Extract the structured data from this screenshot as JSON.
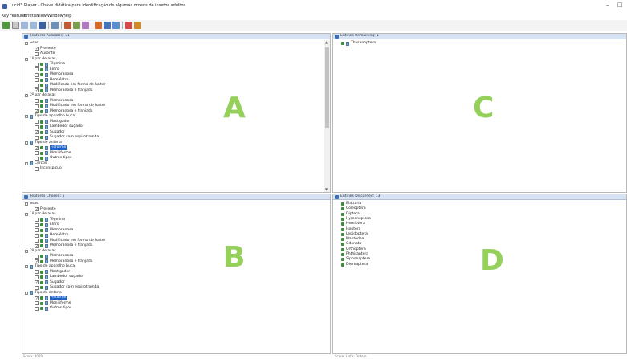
{
  "window": {
    "title": "Lucid3 Player - Chave didática para identificação de algumas ordens de insetos adultos",
    "minimize": "–",
    "maximize": "□"
  },
  "menu": [
    "Key",
    "Features",
    "Entities",
    "View",
    "Window",
    "Help"
  ],
  "toolbar_icons": [
    "restart-icon",
    "open-icon",
    "copy-icon",
    "paste-icon",
    "binoculars-icon",
    "filter-icon",
    "tools-icon",
    "prune-icon",
    "wand-icon",
    "differences-icon",
    "best-icon",
    "next-icon",
    "check-icon",
    "book-icon"
  ],
  "panes": {
    "features_available": {
      "header": "Features Available: 31",
      "letter": "A",
      "rows": [
        {
          "t": "Asas",
          "lvl": 0,
          "kind": "group"
        },
        {
          "t": "Presente",
          "lvl": 1,
          "kind": "state",
          "checked": true
        },
        {
          "t": "Ausente",
          "lvl": 1,
          "kind": "state",
          "checked": false
        },
        {
          "t": "1º par de asas",
          "lvl": 0,
          "kind": "group"
        },
        {
          "t": "Tégmina",
          "lvl": 1,
          "kind": "state2",
          "checked": false
        },
        {
          "t": "Élitro",
          "lvl": 1,
          "kind": "state2",
          "checked": false
        },
        {
          "t": "Membranosa",
          "lvl": 1,
          "kind": "state2",
          "checked": false
        },
        {
          "t": "Hemiélitro",
          "lvl": 1,
          "kind": "state2",
          "checked": false
        },
        {
          "t": "Modificado em forma de halter",
          "lvl": 1,
          "kind": "state2",
          "checked": false
        },
        {
          "t": "Membranosa e franjada",
          "lvl": 1,
          "kind": "state2",
          "checked": true
        },
        {
          "t": "2º par de asas",
          "lvl": 0,
          "kind": "group"
        },
        {
          "t": "Membranosa",
          "lvl": 1,
          "kind": "state2",
          "checked": false
        },
        {
          "t": "Modificado em forma de halter",
          "lvl": 1,
          "kind": "state2",
          "checked": false
        },
        {
          "t": "Membranosa e franjada",
          "lvl": 1,
          "kind": "state2",
          "checked": true
        },
        {
          "t": "Tipo de aparelho bucal",
          "lvl": 0,
          "kind": "group2"
        },
        {
          "t": "Mastigador",
          "lvl": 1,
          "kind": "state2",
          "checked": false
        },
        {
          "t": "Lambedor sugador",
          "lvl": 1,
          "kind": "state2",
          "checked": false
        },
        {
          "t": "Sugador",
          "lvl": 1,
          "kind": "state2",
          "checked": true
        },
        {
          "t": "Sugador com espirotromba",
          "lvl": 1,
          "kind": "state2",
          "checked": false
        },
        {
          "t": "Tipo de antena",
          "lvl": 0,
          "kind": "group2"
        },
        {
          "t": "Filiforme",
          "lvl": 1,
          "kind": "state2",
          "checked": true,
          "selected": true
        },
        {
          "t": "Moniliforme",
          "lvl": 1,
          "kind": "state2",
          "checked": false
        },
        {
          "t": "Outros tipos",
          "lvl": 1,
          "kind": "state2",
          "checked": false
        },
        {
          "t": "Cercos",
          "lvl": 0,
          "kind": "group2"
        },
        {
          "t": "Inconspícuo",
          "lvl": 1,
          "kind": "state",
          "checked": false
        }
      ]
    },
    "features_chosen": {
      "header": "Features Chosen: 5",
      "letter": "B",
      "rows": [
        {
          "t": "Asas",
          "lvl": 0,
          "kind": "group"
        },
        {
          "t": "Presente",
          "lvl": 1,
          "kind": "state",
          "checked": true
        },
        {
          "t": "1º par de asas",
          "lvl": 0,
          "kind": "group"
        },
        {
          "t": "Tégmina",
          "lvl": 1,
          "kind": "state2",
          "checked": false
        },
        {
          "t": "Élitro",
          "lvl": 1,
          "kind": "state2",
          "checked": false
        },
        {
          "t": "Membranosa",
          "lvl": 1,
          "kind": "state2",
          "checked": false
        },
        {
          "t": "Hemiélitro",
          "lvl": 1,
          "kind": "state2",
          "checked": false
        },
        {
          "t": "Modificado em forma de halter",
          "lvl": 1,
          "kind": "state2",
          "checked": false
        },
        {
          "t": "Membranosa e franjada",
          "lvl": 1,
          "kind": "state2",
          "checked": true
        },
        {
          "t": "2º par de asas",
          "lvl": 0,
          "kind": "group"
        },
        {
          "t": "Membranosa",
          "lvl": 1,
          "kind": "state2",
          "checked": false
        },
        {
          "t": "Membranosa e franjada",
          "lvl": 1,
          "kind": "state2",
          "checked": true
        },
        {
          "t": "Tipo de aparelho bucal",
          "lvl": 0,
          "kind": "group2"
        },
        {
          "t": "Mastigador",
          "lvl": 1,
          "kind": "state2",
          "checked": false
        },
        {
          "t": "Lambedor sugador",
          "lvl": 1,
          "kind": "state2",
          "checked": false
        },
        {
          "t": "Sugador",
          "lvl": 1,
          "kind": "state2",
          "checked": true
        },
        {
          "t": "Sugador com espirotromba",
          "lvl": 1,
          "kind": "state2",
          "checked": false
        },
        {
          "t": "Tipo de antena",
          "lvl": 0,
          "kind": "group2"
        },
        {
          "t": "Filiforme",
          "lvl": 1,
          "kind": "state2",
          "checked": true,
          "selected": true
        },
        {
          "t": "Moniliforme",
          "lvl": 1,
          "kind": "state2",
          "checked": false
        },
        {
          "t": "Outros tipos",
          "lvl": 1,
          "kind": "state2",
          "checked": false
        }
      ]
    },
    "entities_remaining": {
      "header": "Entities Remaining: 1",
      "letter": "C",
      "items": [
        "Thysanoptera"
      ]
    },
    "entities_discarded": {
      "header": "Entities Discarded: 13",
      "letter": "D",
      "items": [
        "Blattaria",
        "Coleoptera",
        "Diptera",
        "Hymenoptera",
        "Hemiptera",
        "Isoptera",
        "Lepidoptera",
        "Mantodea",
        "Odonata",
        "Orthoptera",
        "Phthiraptera",
        "Siphonaptera",
        "Dermaptera"
      ]
    }
  },
  "status": {
    "left": "Score: 100%",
    "right": "Score: Lista: Ordem"
  }
}
